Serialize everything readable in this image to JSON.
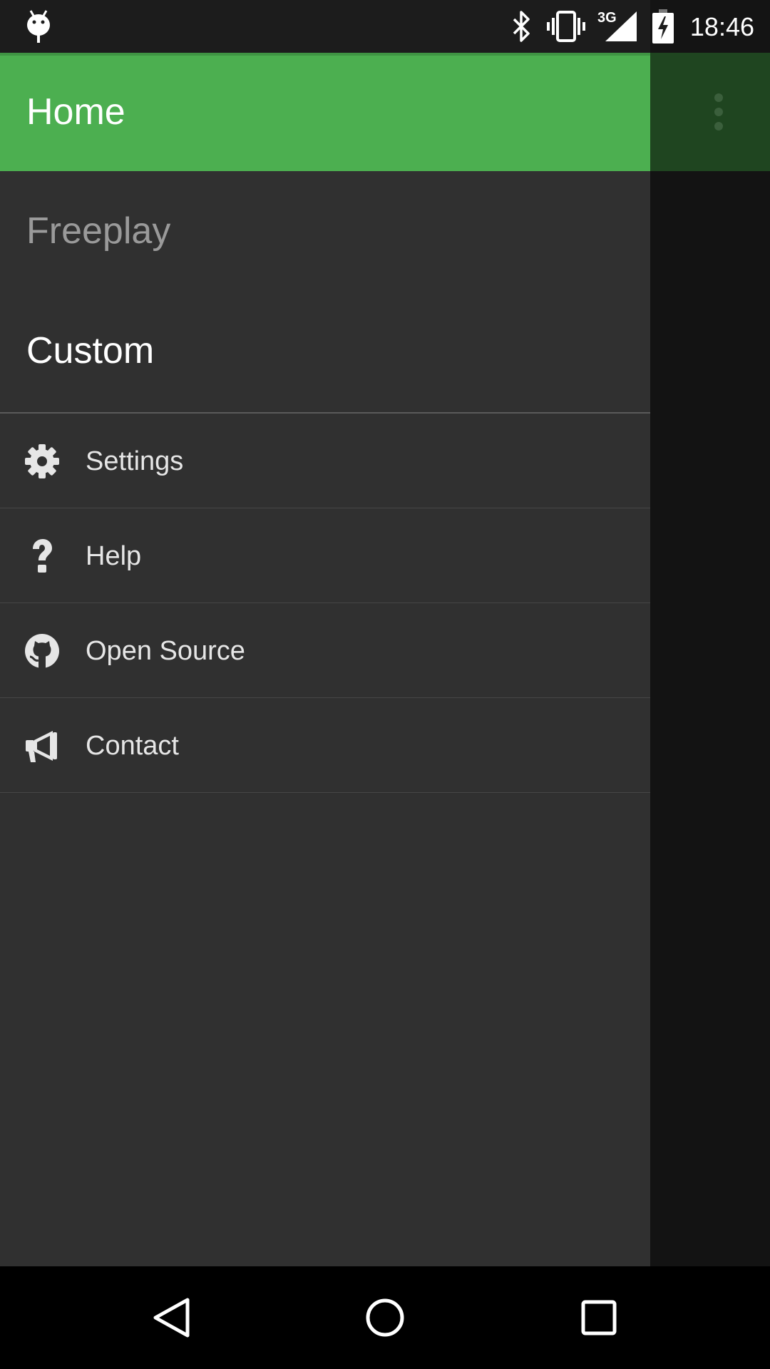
{
  "status_bar": {
    "time": "18:46",
    "network": "3G",
    "icons": [
      "android-debug-icon",
      "bluetooth-icon",
      "vibrate-icon",
      "signal-icon",
      "battery-charging-icon"
    ]
  },
  "drawer": {
    "header_title": "Home",
    "modes": [
      {
        "label": "Freeplay"
      },
      {
        "label": "Custom"
      }
    ],
    "menu": [
      {
        "label": "Settings",
        "icon": "gear-icon"
      },
      {
        "label": "Help",
        "icon": "question-icon"
      },
      {
        "label": "Open Source",
        "icon": "github-icon"
      },
      {
        "label": "Contact",
        "icon": "megaphone-icon"
      }
    ]
  },
  "toolbar": {
    "overflow_icon": "more-vert-icon"
  },
  "nav_bar": {
    "buttons": [
      "back-icon",
      "home-icon",
      "recents-icon"
    ]
  },
  "colors": {
    "header_green": "#4caf50",
    "drawer_bg": "#303030",
    "scrim_toolbar": "#1f4520"
  }
}
